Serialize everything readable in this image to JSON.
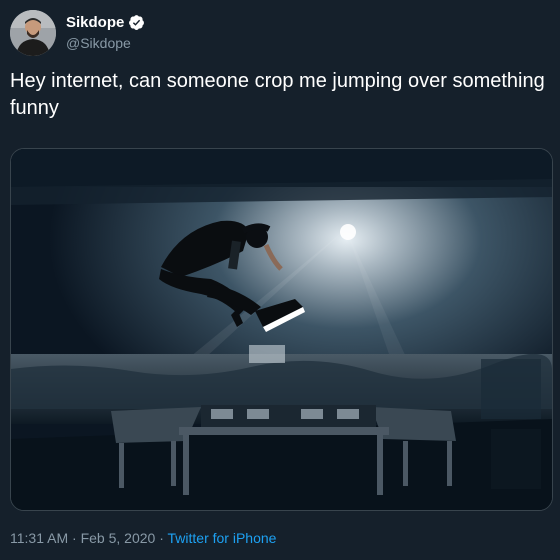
{
  "author": {
    "display_name": "Sikdope",
    "handle": "@Sikdope",
    "verified": true,
    "avatar_icon": "avatar-photo"
  },
  "tweet": {
    "text": "Hey internet, can someone crop me jumping over something funny"
  },
  "media": {
    "type": "photo",
    "icon": "concert-photo"
  },
  "footer": {
    "time": "11:31 AM",
    "separator1": "·",
    "date": "Feb 5, 2020",
    "separator2": "·",
    "source": "Twitter for iPhone"
  },
  "colors": {
    "background": "#15202b",
    "secondary_text": "#8899a6",
    "link": "#1da1f2",
    "verified_badge": "#ffffff"
  }
}
